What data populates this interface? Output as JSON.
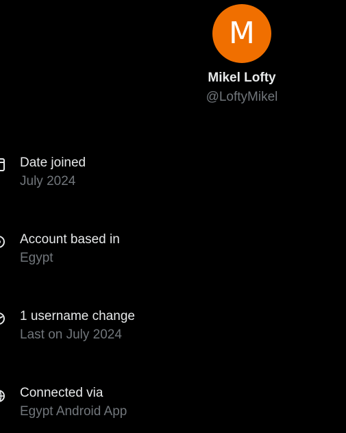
{
  "profile": {
    "avatar_letter": "M",
    "avatar_color": "#f06f00",
    "display_name": "Mikel Lofty",
    "handle": "@LoftyMikel"
  },
  "rows": [
    {
      "icon": "calendar-icon",
      "title": "Date joined",
      "subtitle": "July 2024"
    },
    {
      "icon": "location-icon",
      "title": "Account based in",
      "subtitle": "Egypt"
    },
    {
      "icon": "username-change-icon",
      "title": "1 username change",
      "subtitle": "Last on July 2024"
    },
    {
      "icon": "globe-icon",
      "title": "Connected via",
      "subtitle": "Egypt Android App"
    }
  ],
  "colors": {
    "background": "#000000",
    "primary_text": "#e7e9ea",
    "secondary_text": "#71767b"
  }
}
